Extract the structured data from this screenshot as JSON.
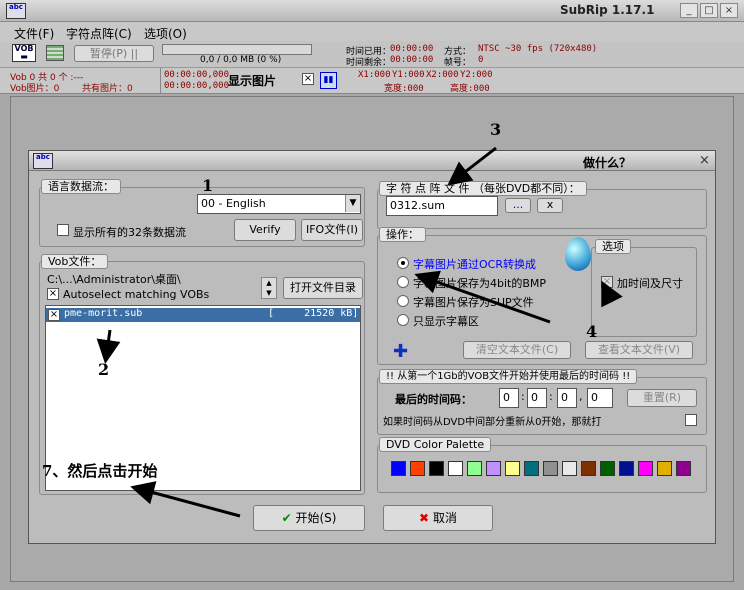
{
  "window": {
    "title": "SubRip 1.17.1",
    "logo": "abc"
  },
  "menu": {
    "file": "文件(F)",
    "charmatrix": "字符点阵(C)",
    "options": "选项(O)"
  },
  "toolbar": {
    "pause": "暂停(P)",
    "progress_text": "0,0 / 0,0 MB (0 %)",
    "elapsed_label": "时间已用：",
    "elapsed": "00:00:00",
    "remain_label": "时间剩余：",
    "remain": "00:00:00",
    "mode_label": "方式：",
    "mode": "NTSC ~30 fps (720x480)",
    "frames_label": "帧号：",
    "frames": "0"
  },
  "info": {
    "vob_line1": "Vob 0 共 0 个 :---",
    "vob_line2": "Vob图片：0",
    "total_pics": "共有图片：0",
    "time1": "00:00:00,000",
    "time2": "00:00:00,000",
    "show_pic": "显示图片",
    "x1": "X1:000",
    "y1": "Y1:000",
    "x2": "X2:000",
    "y2": "Y2:000",
    "width": "宽度:000",
    "height": "高度:000"
  },
  "dialog": {
    "title": "做什么？",
    "lang_group": "语言数据流：",
    "lang_select": "00 - English",
    "show_all_streams": "显示所有的32条数据流",
    "verify": "Verify",
    "ifo_file": "IFO文件(I)",
    "vob_group": "Vob文件：",
    "vob_path": "C:\\...\\Administrator\\桌面\\",
    "autoselect": "Autoselect matching VOBs",
    "open_dir": "打开文件目录",
    "vob_item_name": "pme-morit.sub",
    "vob_item_size": "[     21520 kB]",
    "charfile_group": "字 符 点 阵 文 件      （每张DVD都不同）：",
    "charfile_value": "0312.sum",
    "browse": "...",
    "clear_x": "x",
    "ops_group": "操作：",
    "op1": "字幕图片通过OCR转换成",
    "op2": "字幕图片保存为4bit的BMP",
    "op3": "字幕图片保存为SUP文件",
    "op4": "只显示字幕区",
    "options_group": "选项",
    "add_time_size": "加时间及尺寸",
    "clear_text_file": "清空文本文件(C)",
    "view_text_file": "查看文本文件(V)",
    "timecode_group": "!! 从第一个1Gb的VOB文件开始并使用最后的时间码 !!",
    "last_timecode": "最后的时间码：",
    "tc": [
      "0",
      "0",
      "0",
      "0"
    ],
    "reset": "重置(R)",
    "restart_note": "如果时间码从DVD中间部分重新从0开始，那就打",
    "palette_group": "DVD Color Palette",
    "palette": [
      "#0000ff",
      "#ff4000",
      "#000000",
      "#ffffff",
      "#90ff90",
      "#c090ff",
      "#ffff90",
      "#007080",
      "#909090",
      "#e8e8e8",
      "#803000",
      "#006000",
      "#001090",
      "#ff00ff",
      "#e0b000",
      "#900090"
    ],
    "start": "开始(S)",
    "cancel": "取消"
  },
  "annotations": {
    "n1": "1",
    "n2": "2",
    "n3": "3",
    "n4": "4",
    "n7": "7、然后点击开始"
  }
}
